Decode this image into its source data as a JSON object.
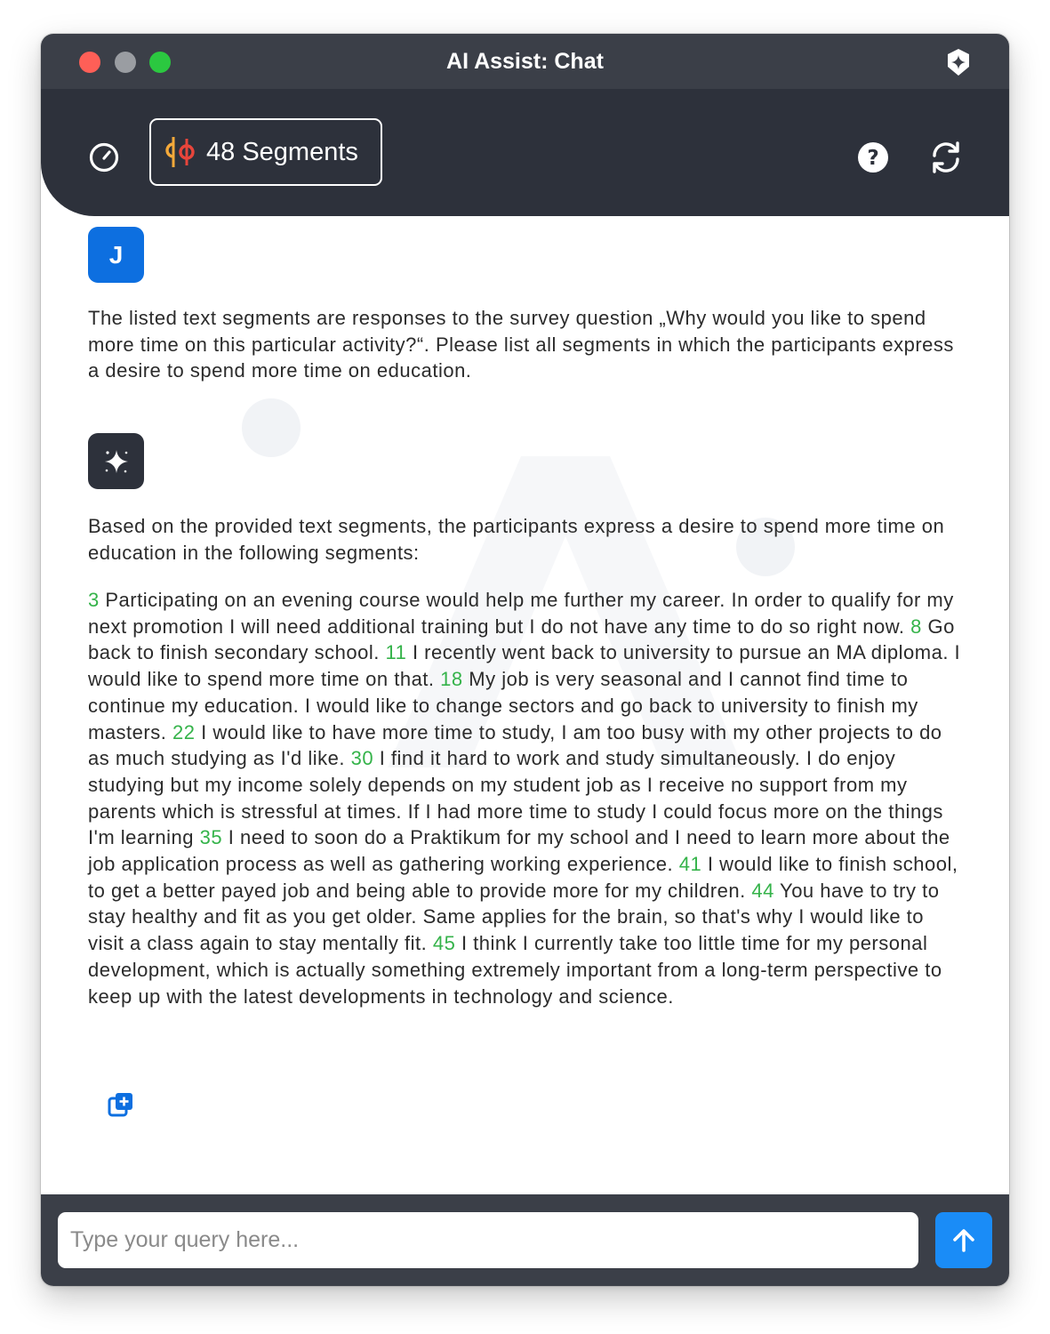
{
  "window": {
    "title": "AI Assist: Chat"
  },
  "toolbar": {
    "segments_label": "48 Segments"
  },
  "chat": {
    "user": {
      "avatar_initial": "J",
      "message": "The listed text segments are responses to the survey question „Why would you like to spend more time on this particular activity?“. Please list all segments in which the participants express a desire to spend more time on education."
    },
    "assistant": {
      "intro": "Based on the provided text segments, the participants express a desire to spend more time on education in the following segments:",
      "segments": [
        {
          "id": "3",
          "text": "Participating on an evening course would help me further my career. In order to qualify for my next promotion I will need additional training but I do not have any time to do so right now."
        },
        {
          "id": "8",
          "text": "Go back to finish secondary school."
        },
        {
          "id": "11",
          "text": "I recently went back to university to pursue an MA diploma. I would like to spend more time on that."
        },
        {
          "id": "18",
          "text": "My job is very seasonal and I cannot find time to continue my education. I would like to change sectors and go back to university to finish my masters."
        },
        {
          "id": "22",
          "text": "I would like to have more time to study, I am too busy with my other projects to do as much studying as I'd like."
        },
        {
          "id": "30",
          "text": "I find it hard to work and study simultaneously. I do enjoy studying but my income solely depends on my student job as I receive no support from my parents which is stressful at times. If I had more time to study I could focus more on the things I'm learning"
        },
        {
          "id": "35",
          "text": "I need to soon do a Praktikum for my school and I need to learn more about the job application process as well as gathering working experience."
        },
        {
          "id": "41",
          "text": "I would like to finish school, to get a better payed job and being able to provide more for my children."
        },
        {
          "id": "44",
          "text": "You have to try to stay healthy and fit as you get older. Same applies for the brain, so that's why I would like to visit a class again to stay mentally fit."
        },
        {
          "id": "45",
          "text": "I think I currently take too little time for my personal development, which is actually something extremely important from a long-term perspective to keep up with the latest developments in technology and science."
        }
      ]
    }
  },
  "input": {
    "placeholder": "Type your query here..."
  },
  "colors": {
    "titlebar": "#3b3f48",
    "toolbar": "#2d313b",
    "user_avatar": "#0d6fe0",
    "segment_number": "#35b34a",
    "send_button": "#1a8cf7"
  },
  "icons": {
    "brand": "sparkle-badge-icon",
    "dashboard": "gauge-icon",
    "segments": "segments-icon",
    "help": "question-circle-icon",
    "refresh": "refresh-icon",
    "assistant": "sparkle-icon",
    "copy": "copy-plus-icon",
    "send": "arrow-up-icon"
  }
}
